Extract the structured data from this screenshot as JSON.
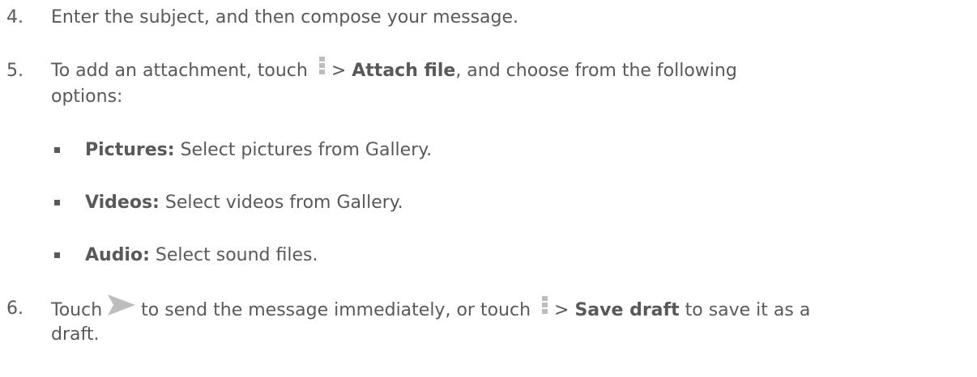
{
  "steps": [
    {
      "number": "4.",
      "text": "Enter the subject, and then compose your message."
    },
    {
      "number": "5.",
      "text_before": "To add an attachment, touch",
      "separator": ">",
      "bold": "Attach file",
      "text_after": ", and choose from the following",
      "line2": "options:",
      "options": [
        {
          "label": "Pictures:",
          "desc": "Select pictures from Gallery."
        },
        {
          "label": "Videos:",
          "desc": "Select videos from Gallery."
        },
        {
          "label": "Audio:",
          "desc": "Select sound files."
        }
      ]
    },
    {
      "number": "6.",
      "text_before": "Touch",
      "text_middle": "to send the message immediately, or touch",
      "separator": ">",
      "bold": "Save draft",
      "text_after": "to save it as a",
      "line2": "draft."
    }
  ],
  "colors": {
    "text": "#595959",
    "icon": "#bdbdbd"
  },
  "icons": {
    "menu": "more-vertical-icon",
    "send": "send-icon"
  }
}
